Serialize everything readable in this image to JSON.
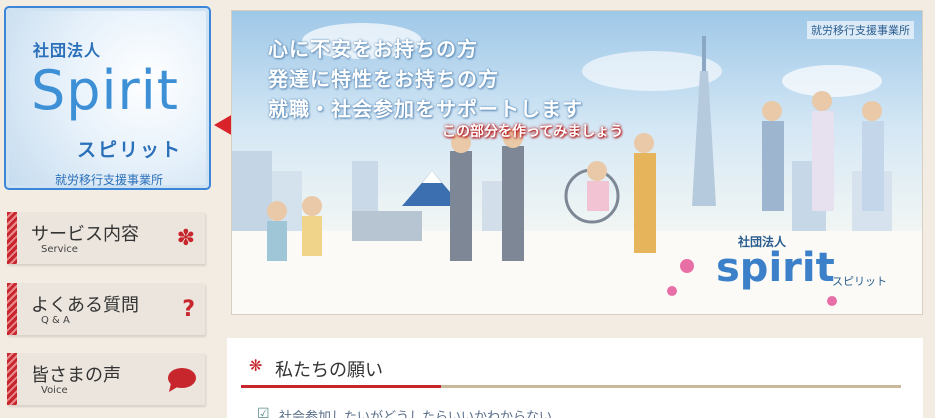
{
  "logo": {
    "corp": "社団法人",
    "name": "Spirit",
    "kana": "スピリット",
    "sub": "就労移行支援事業所"
  },
  "banner": {
    "tag": "就労移行支援事業所",
    "lines": [
      "心に不安をお持ちの方",
      "発達に特性をお持ちの方",
      "就職・社会参加をサポートします"
    ],
    "callout": "この部分を作ってみましょう",
    "brand_corp": "社団法人",
    "brand_name": "spirit",
    "brand_kana": "スピリット"
  },
  "nav": [
    {
      "title": "サービス内容",
      "sub": "Service",
      "icon": "asterisk-flower-icon"
    },
    {
      "title": "よくある質問",
      "sub": "Q & A",
      "icon": "question-icon"
    },
    {
      "title": "皆さまの声",
      "sub": "Voice",
      "icon": "speech-bubble-icon"
    }
  ],
  "section": {
    "mark": "❋",
    "title": "私たちの願い",
    "next_line": "社会参加したいがどうしたらいいかわからない"
  },
  "colors": {
    "accent_red": "#c8262d",
    "logo_blue": "#3d8fd6",
    "background": "#f3ece2"
  }
}
